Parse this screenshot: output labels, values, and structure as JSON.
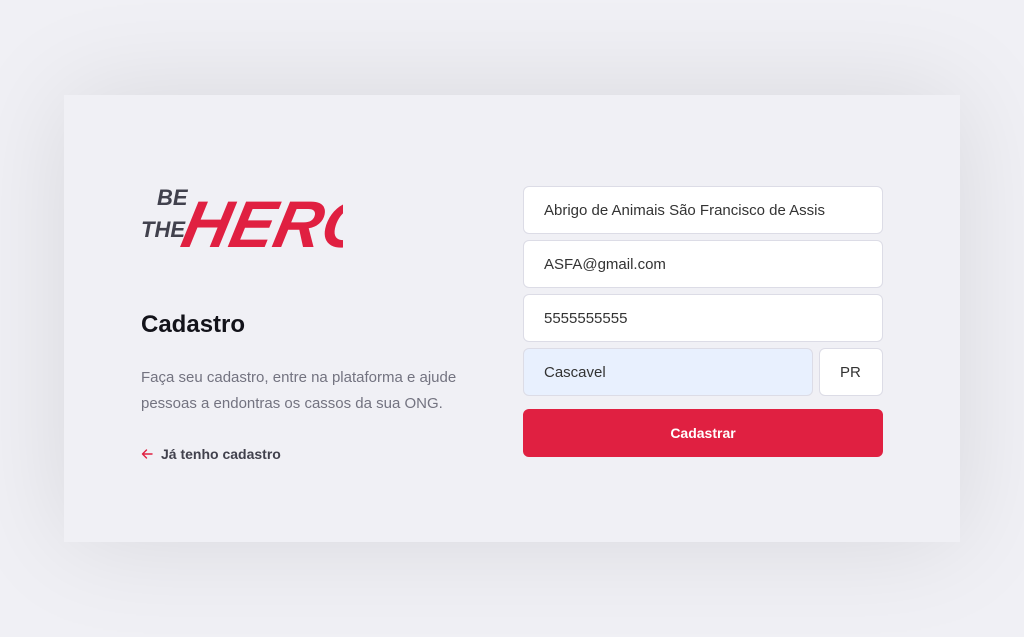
{
  "logo_text": "BE THE HERO",
  "register": {
    "title": "Cadastro",
    "description": "Faça seu cadastro, entre na plataforma e ajude pessoas a endontras os cassos da sua ONG.",
    "back_link_label": "Já tenho cadastro"
  },
  "form": {
    "name_value": "Abrigo de Animais São Francisco de Assis",
    "email_value": "ASFA@gmail.com",
    "whatsapp_value": "5555555555",
    "city_value": "Cascavel",
    "uf_value": "PR",
    "submit_label": "Cadastrar"
  },
  "colors": {
    "brand": "#e02041",
    "background": "#f0f0f5",
    "autofill": "#e8f0fe"
  },
  "icons": {
    "back": "arrow-left-icon"
  }
}
